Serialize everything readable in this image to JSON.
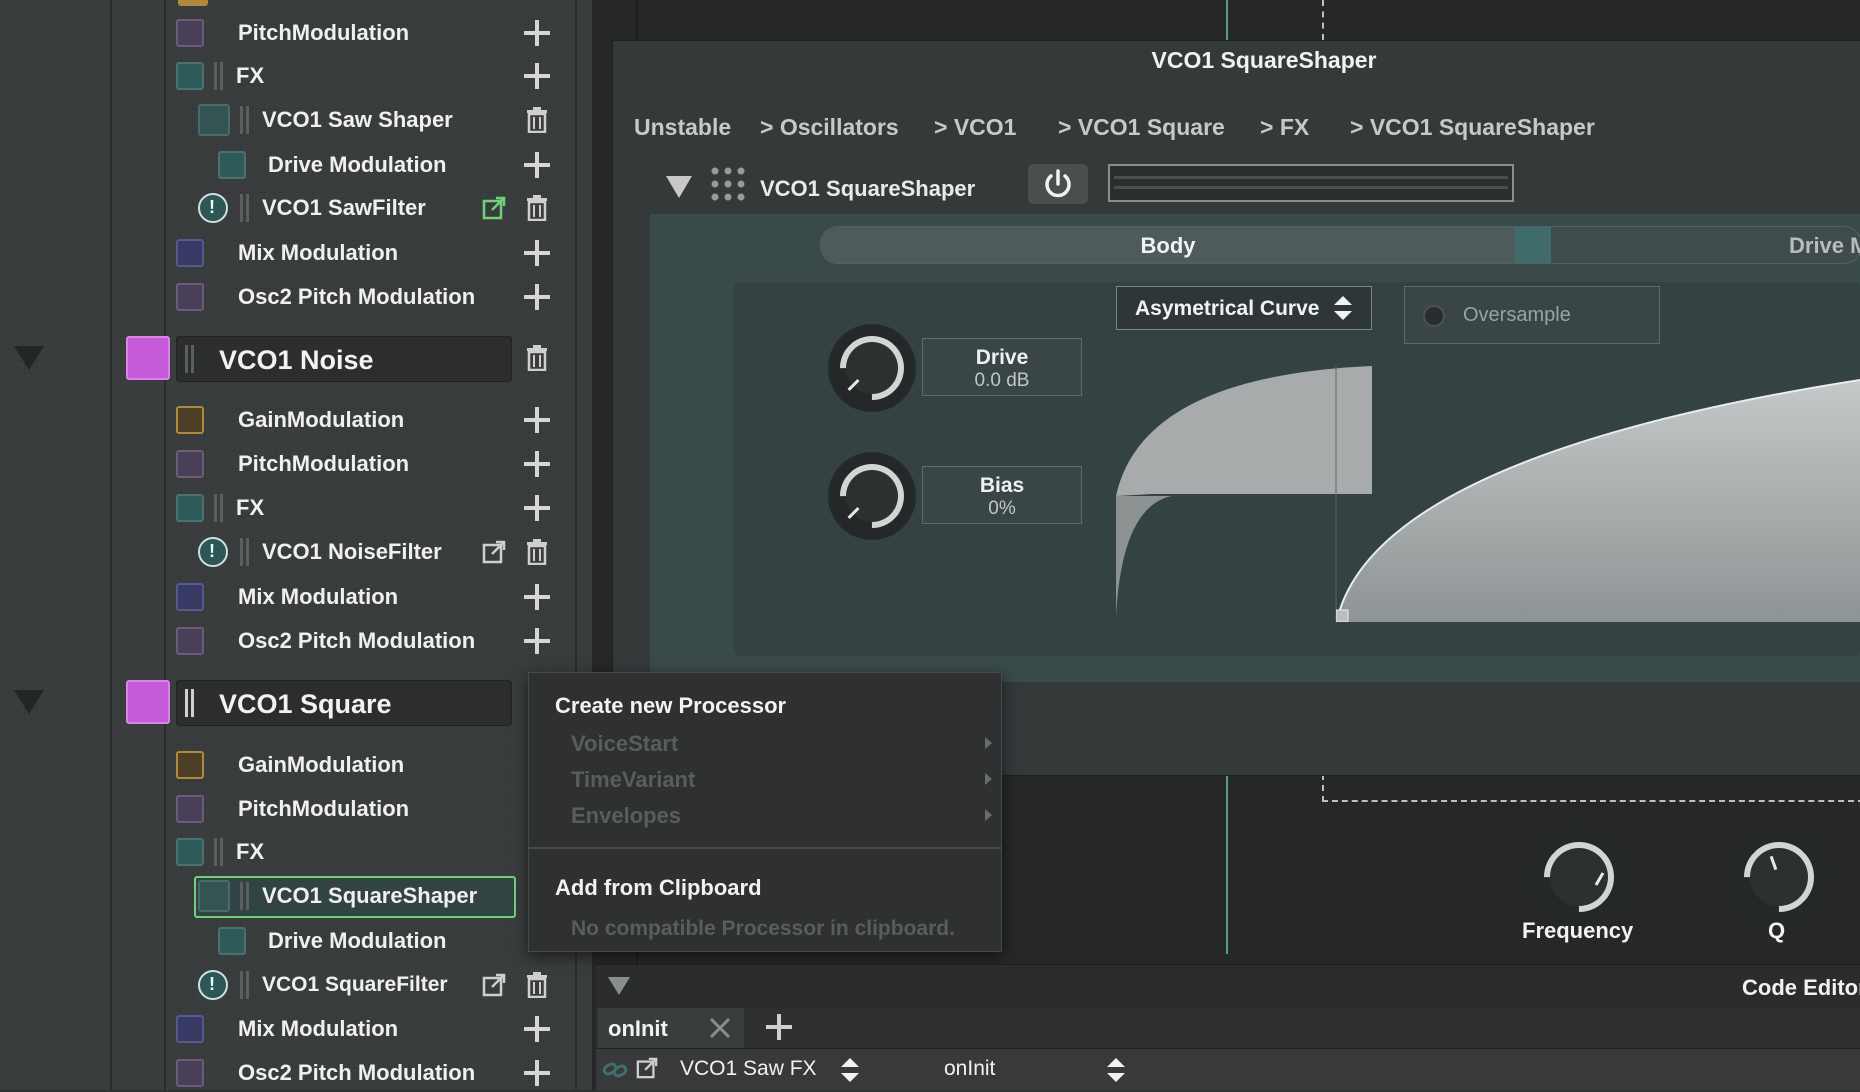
{
  "tree": {
    "rows": [
      {
        "label": "PitchModulation",
        "type": "purple",
        "action": "add"
      },
      {
        "label": "FX",
        "type": "teal",
        "action": "add"
      },
      {
        "label": "VCO1 Saw Shaper",
        "type": "teal2",
        "action": "delete"
      },
      {
        "label": "Drive Modulation",
        "type": "teal",
        "action": "add"
      },
      {
        "label": "VCO1 SawFilter",
        "type": "clock",
        "action": "delete"
      },
      {
        "label": "Mix Modulation",
        "type": "blue",
        "action": "add"
      },
      {
        "label": "Osc2 Pitch Modulation",
        "type": "purple",
        "action": "add"
      },
      {
        "label": "VCO1 Noise",
        "type": "magenta",
        "action": "delete"
      },
      {
        "label": "GainModulation",
        "type": "orange",
        "action": "add"
      },
      {
        "label": "PitchModulation",
        "type": "purple",
        "action": "add"
      },
      {
        "label": "FX",
        "type": "teal",
        "action": "add"
      },
      {
        "label": "VCO1 NoiseFilter",
        "type": "clock",
        "action": "delete"
      },
      {
        "label": "Mix Modulation",
        "type": "blue",
        "action": "add"
      },
      {
        "label": "Osc2 Pitch Modulation",
        "type": "purple",
        "action": "add"
      },
      {
        "label": "VCO1 Square",
        "type": "magenta",
        "action": "none"
      },
      {
        "label": "GainModulation",
        "type": "orange",
        "action": "none"
      },
      {
        "label": "PitchModulation",
        "type": "purple",
        "action": "none"
      },
      {
        "label": "FX",
        "type": "teal",
        "action": "none"
      },
      {
        "label": "VCO1 SquareShaper",
        "type": "teal2",
        "action": "none",
        "selected": true
      },
      {
        "label": "Drive Modulation",
        "type": "teal",
        "action": "none"
      },
      {
        "label": "VCO1 SquareFilter",
        "type": "clock",
        "action": "delete"
      },
      {
        "label": "Mix Modulation",
        "type": "blue",
        "action": "add"
      },
      {
        "label": "Osc2 Pitch Modulation",
        "type": "purple",
        "action": "add"
      }
    ]
  },
  "panel": {
    "title": "VCO1 SquareShaper",
    "breadcrumb": [
      "Unstable",
      "> Oscillators",
      "> VCO1",
      "> VCO1 Square",
      "> FX",
      "> VCO1 SquareShaper"
    ],
    "processor_name": "VCO1 SquareShaper",
    "tabs": [
      "Body",
      "Drive Mc"
    ],
    "curve_select": "Asymetrical Curve",
    "oversample_label": "Oversample",
    "drive": {
      "name": "Drive",
      "value": "0.0 dB"
    },
    "bias": {
      "name": "Bias",
      "value": "0%"
    }
  },
  "filter_knobs": {
    "frequency": "Frequency",
    "q": "Q"
  },
  "context_menu": {
    "header1": "Create new Processor",
    "items": [
      "VoiceStart",
      "TimeVariant",
      "Envelopes"
    ],
    "header2": "Add from Clipboard",
    "note": "No compatible Processor in clipboard."
  },
  "code_editor": {
    "title": "Code Editor",
    "tab": "onInit",
    "processor_select": "VCO1 Saw FX",
    "callback_select": "onInit"
  },
  "colors": {
    "accent_green": "#6fd07a",
    "magenta": "#c45ad8"
  }
}
